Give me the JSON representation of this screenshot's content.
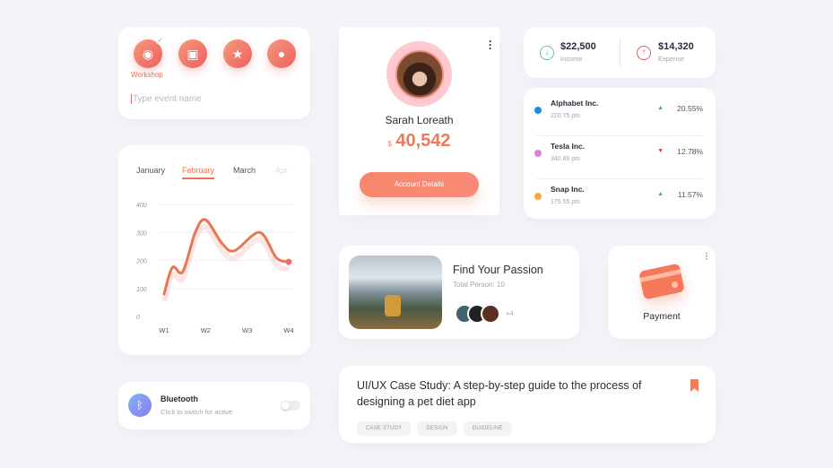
{
  "events": {
    "icons": [
      "camera-icon",
      "gift-icon",
      "star-icon",
      "user-icon"
    ],
    "selected_label": "Workshop",
    "placeholder": "Type event name"
  },
  "chart": {
    "tabs": [
      "January",
      "February",
      "March",
      "Apr"
    ],
    "active_tab": "February"
  },
  "chart_data": {
    "type": "line",
    "categories": [
      "W1",
      "W2",
      "W3",
      "W4"
    ],
    "yticks": [
      0,
      100,
      200,
      300,
      400
    ],
    "ylim": [
      0,
      400
    ],
    "grid": true,
    "x": [
      1,
      1.2,
      1.45,
      1.75,
      2,
      2.4,
      2.7,
      3.3,
      3.7,
      4
    ],
    "y": [
      80,
      175,
      160,
      300,
      345,
      260,
      235,
      300,
      210,
      195
    ],
    "color": "#e8764f"
  },
  "bluetooth": {
    "title": "Bluetooth",
    "subtitle": "Click to switch for active",
    "enabled": false
  },
  "profile": {
    "name": "Sarah Loreath",
    "currency": "$",
    "balance": "40,542",
    "button": "Account Details"
  },
  "finance": {
    "income": {
      "amount": "$22,500",
      "label": "Income",
      "color": "#5cc98a"
    },
    "expense": {
      "amount": "$14,320",
      "label": "Expense",
      "color": "#e0605a"
    }
  },
  "stocks": [
    {
      "name": "Alphabet Inc.",
      "pts": "220.75 pts",
      "change": "20.55%",
      "trend": "up",
      "color": "#1e88e5"
    },
    {
      "name": "Tesla Inc.",
      "pts": "340.89 pts",
      "change": "12.78%",
      "trend": "down",
      "color": "#d97fd6"
    },
    {
      "name": "Snap Inc.",
      "pts": "175.55 pts",
      "change": "11.57%",
      "trend": "up",
      "color": "#f6a940"
    }
  ],
  "passion": {
    "title": "Find Your Passion",
    "subtitle": "Total Person: 10",
    "more": "+4"
  },
  "payment": {
    "label": "Payment"
  },
  "article": {
    "title": "UI/UX Case Study: A step-by-step guide to the process of designing a pet diet app",
    "tags": [
      "CASE STUDY",
      "DESIGN",
      "GUIDELINE"
    ]
  }
}
